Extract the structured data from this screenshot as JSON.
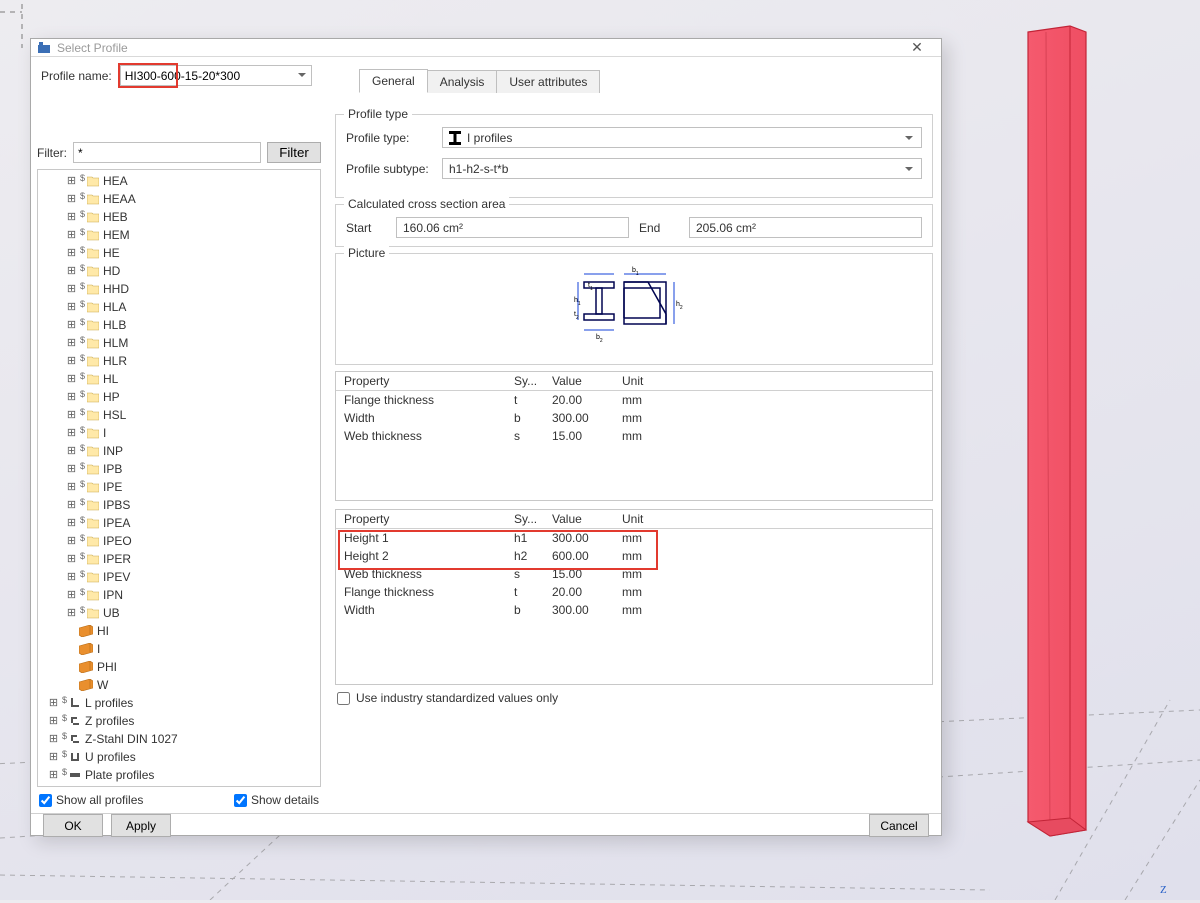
{
  "window": {
    "title": "Select Profile",
    "close_glyph": "✕"
  },
  "profileName": {
    "label": "Profile name:",
    "value": "HI300-600-15-20*300"
  },
  "filter": {
    "label": "Filter:",
    "value": "*",
    "button": "Filter"
  },
  "tree": {
    "i_profiles": [
      "HEA",
      "HEAA",
      "HEB",
      "HEM",
      "HE",
      "HD",
      "HHD",
      "HLA",
      "HLB",
      "HLM",
      "HLR",
      "HL",
      "HP",
      "HSL",
      "I",
      "INP",
      "IPB",
      "IPE",
      "IPBS",
      "IPEA",
      "IPEO",
      "IPER",
      "IPEV",
      "IPN",
      "UB"
    ],
    "orange": [
      "HI",
      "I",
      "PHI",
      "W"
    ],
    "after": [
      "L profiles",
      "Z profiles",
      "Z-Stahl DIN 1027",
      "U profiles",
      "Plate profiles"
    ]
  },
  "checks": {
    "showAll": "Show all profiles",
    "showDetails": "Show details"
  },
  "tabs": {
    "general": "General",
    "analysis": "Analysis",
    "user": "User attributes"
  },
  "profileType": {
    "groupTitle": "Profile type",
    "typeLabel": "Profile type:",
    "typeValue": "I profiles",
    "subtypeLabel": "Profile subtype:",
    "subtypeValue": "h1-h2-s-t*b"
  },
  "csa": {
    "groupTitle": "Calculated cross section area",
    "startLabel": "Start",
    "startValue": "160.06 cm²",
    "endLabel": "End",
    "endValue": "205.06 cm²"
  },
  "picture": {
    "groupTitle": "Picture"
  },
  "propHeaders": {
    "property": "Property",
    "symbol": "Sy...",
    "value": "Value",
    "unit": "Unit"
  },
  "propsA": [
    {
      "p": "Flange thickness",
      "s": "t",
      "v": "20.00",
      "u": "mm"
    },
    {
      "p": "Width",
      "s": "b",
      "v": "300.00",
      "u": "mm"
    },
    {
      "p": "Web thickness",
      "s": "s",
      "v": "15.00",
      "u": "mm"
    }
  ],
  "propsB": [
    {
      "p": "Height 1",
      "s": "h1",
      "v": "300.00",
      "u": "mm"
    },
    {
      "p": "Height 2",
      "s": "h2",
      "v": "600.00",
      "u": "mm"
    },
    {
      "p": "Web thickness",
      "s": "s",
      "v": "15.00",
      "u": "mm"
    },
    {
      "p": "Flange thickness",
      "s": "t",
      "v": "20.00",
      "u": "mm"
    },
    {
      "p": "Width",
      "s": "b",
      "v": "300.00",
      "u": "mm"
    }
  ],
  "useStd": "Use industry standardized values only",
  "buttons": {
    "ok": "OK",
    "apply": "Apply",
    "cancel": "Cancel"
  }
}
